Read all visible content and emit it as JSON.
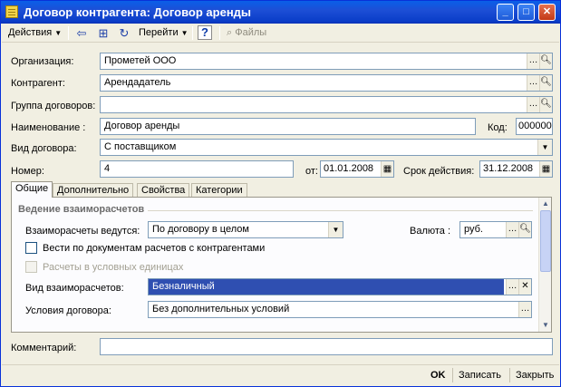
{
  "window": {
    "title": "Договор контрагента: Договор аренды"
  },
  "toolbar": {
    "actions": "Действия",
    "goto": "Перейти",
    "help": "?",
    "files": "Файлы"
  },
  "form": {
    "org_label": "Организация:",
    "org_value": "Прометей ООО",
    "contr_label": "Контрагент:",
    "contr_value": "Арендадатель",
    "group_label": "Группа договоров:",
    "group_value": "",
    "name_label": "Наименование :",
    "name_value": "Договор аренды",
    "code_label": "Код:",
    "code_value": "000000",
    "type_label": "Вид договора:",
    "type_value": "С поставщиком",
    "num_label": "Номер:",
    "num_value": "4",
    "from_label": "от:",
    "from_value": "01.01.2008",
    "valid_label": "Срок действия:",
    "valid_value": "31.12.2008",
    "comment_label": "Комментарий:",
    "comment_value": ""
  },
  "tabs": [
    "Общие",
    "Дополнительно",
    "Свойства",
    "Категории"
  ],
  "panel": {
    "section_title": "Ведение взаиморасчетов",
    "settlement_label": "Взаиморасчеты ведутся:",
    "settlement_value": "По договору в целом",
    "currency_label": "Валюта :",
    "currency_value": "руб.",
    "by_docs_label": "Вести по документам расчетов с контрагентами",
    "conv_units_label": "Расчеты в условных единицах",
    "settle_kind_label": "Вид взаиморасчетов:",
    "settle_kind_value": "Безналичный",
    "terms_label": "Условия договора:",
    "terms_value": "Без дополнительных условий"
  },
  "footer": {
    "ok": "OK",
    "write": "Записать",
    "close": "Закрыть"
  }
}
